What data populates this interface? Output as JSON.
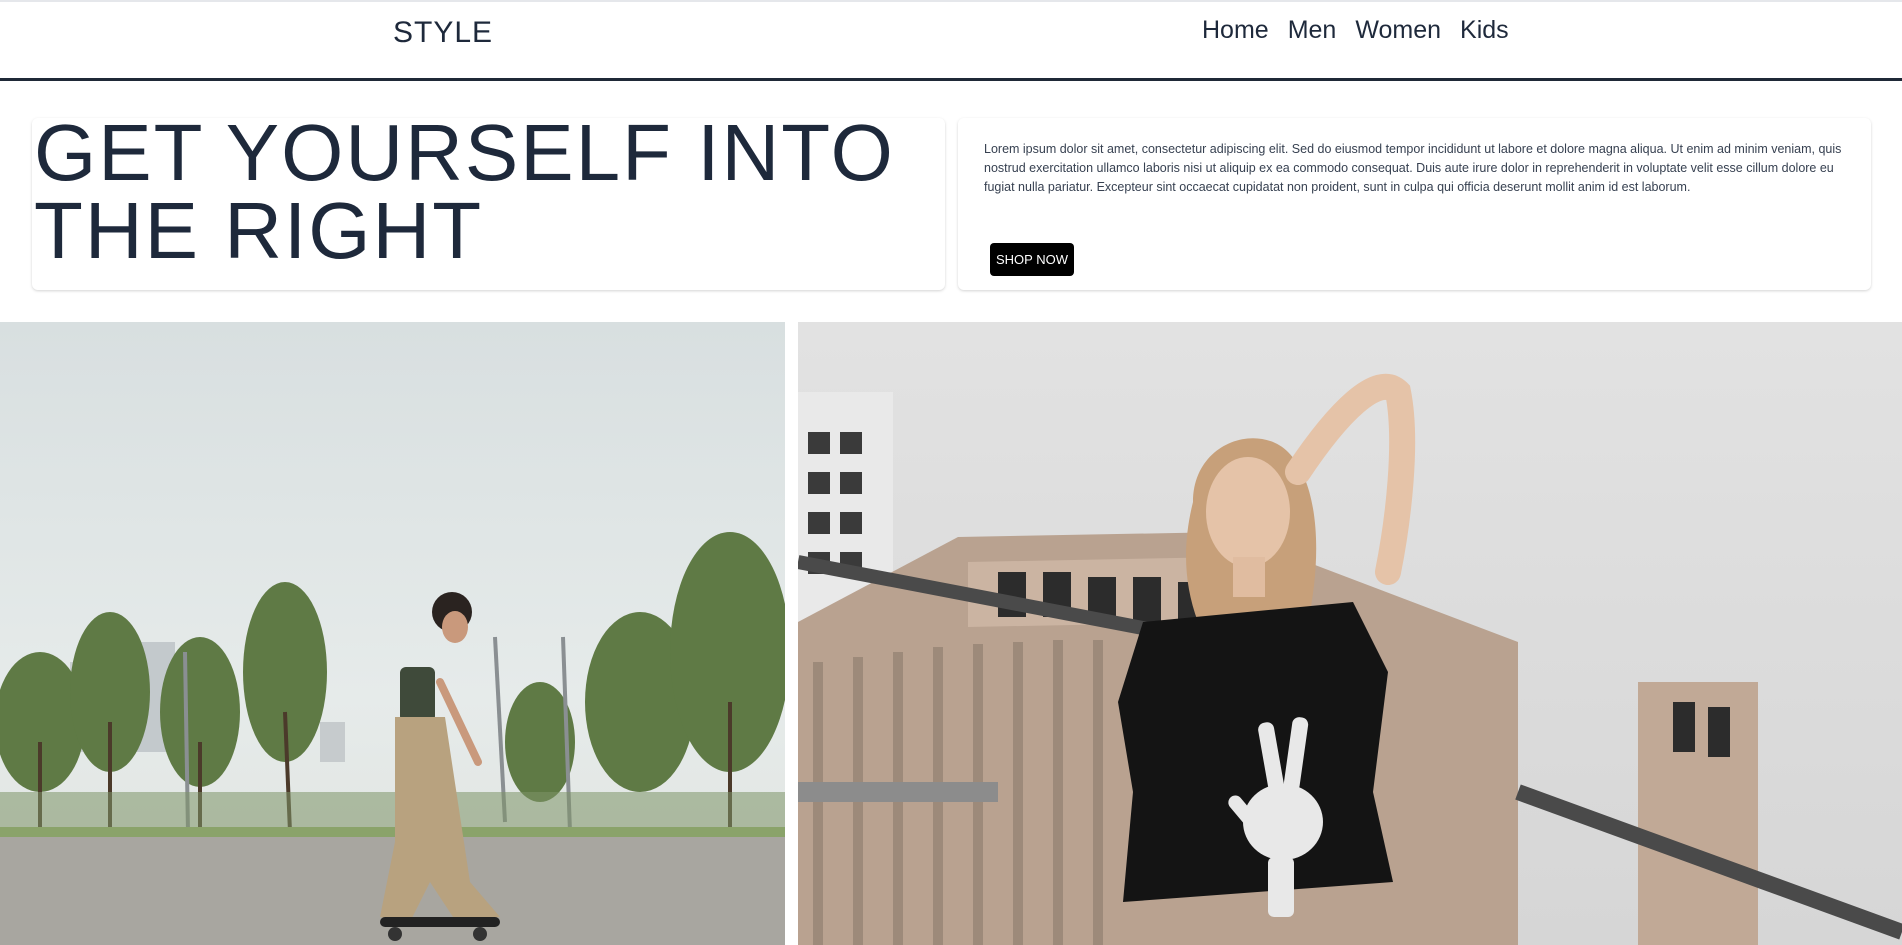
{
  "brand": "STYLE",
  "nav": [
    "Home",
    "Men",
    "Women",
    "Kids"
  ],
  "hero": {
    "headline_line1": "GET YOURSELF INTO",
    "headline_line2": "THE RIGHT",
    "description": "Lorem ipsum dolor sit amet, consectetur adipiscing elit. Sed do eiusmod tempor incididunt ut labore et dolore magna aliqua. Ut enim ad minim veniam, quis nostrud exercitation ullamco laboris nisi ut aliquip ex ea commodo consequat. Duis aute irure dolor in reprehenderit in voluptate velit esse cillum dolore eu fugiat nulla pariatur. Excepteur sint occaecat cupidatat non proident, sunt in culpa qui officia deserunt mollit anim id est laborum.",
    "button": "SHOP NOW"
  },
  "images": {
    "left_alt": "woman skateboarding in a park",
    "right_alt": "woman in black skeleton-hand t-shirt in front of building"
  },
  "colors": {
    "text": "#1e293b",
    "button_bg": "#000000",
    "button_text": "#ffffff",
    "header_border": "#1f2937"
  }
}
